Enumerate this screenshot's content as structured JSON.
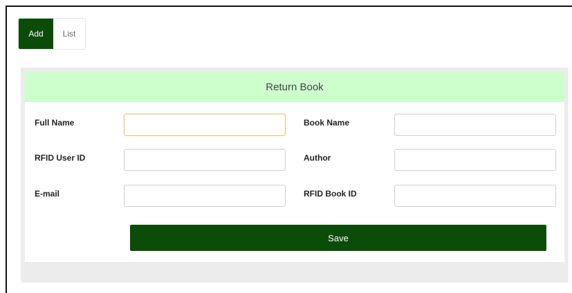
{
  "tabs": {
    "add_label": "Add",
    "list_label": "List"
  },
  "form": {
    "title": "Return Book",
    "labels": {
      "full_name": "Full Name",
      "rfid_user_id": "RFID User ID",
      "email": "E-mail",
      "book_name": "Book Name",
      "author": "Author",
      "rfid_book_id": "RFID Book ID"
    },
    "values": {
      "full_name": "",
      "rfid_user_id": "",
      "email": "",
      "book_name": "",
      "author": "",
      "rfid_book_id": ""
    },
    "save_label": "Save"
  },
  "colors": {
    "primary": "#0b4d08",
    "header_bg": "#ccffcc",
    "focus_border": "#e8c66a"
  }
}
